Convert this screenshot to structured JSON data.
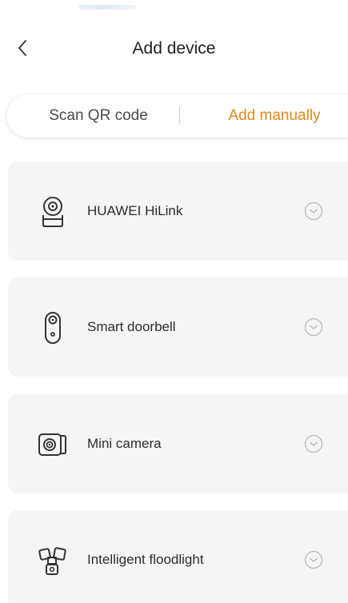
{
  "header": {
    "back_icon": "chevron-left-icon",
    "title": "Add device"
  },
  "tabs": {
    "scan_label": "Scan QR code",
    "manual_label": "Add manually",
    "active": "manual",
    "active_color": "#e0891b"
  },
  "devices": [
    {
      "label": "HUAWEI HiLink",
      "icon": "hilink-camera-icon"
    },
    {
      "label": "Smart doorbell",
      "icon": "doorbell-icon"
    },
    {
      "label": "Mini camera",
      "icon": "mini-camera-icon"
    },
    {
      "label": "Intelligent floodlight",
      "icon": "floodlight-icon"
    }
  ],
  "expand_icon": "chevron-down-circle-icon"
}
